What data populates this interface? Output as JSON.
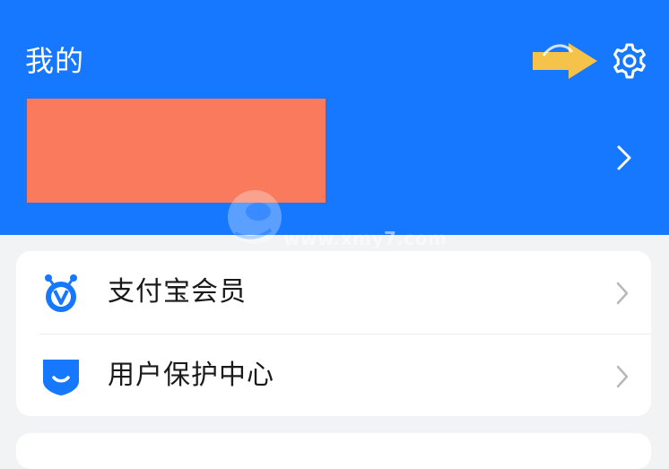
{
  "header": {
    "title": "我的",
    "background_color": "#1677ff",
    "settings_icon": "gear-icon",
    "annotation_icon": "arrow-right-icon",
    "annotation_color": "#f5c24a",
    "profile_chevron_icon": "chevron-right-icon",
    "redaction_color": "#f97a5d"
  },
  "watermark": {
    "text": "www.xmy7.com"
  },
  "menu": {
    "items": [
      {
        "label": "支付宝会员",
        "icon": "alipay-member-icon",
        "icon_color": "#1677ff"
      },
      {
        "label": "用户保护中心",
        "icon": "shield-icon",
        "icon_color": "#1677ff"
      }
    ]
  }
}
